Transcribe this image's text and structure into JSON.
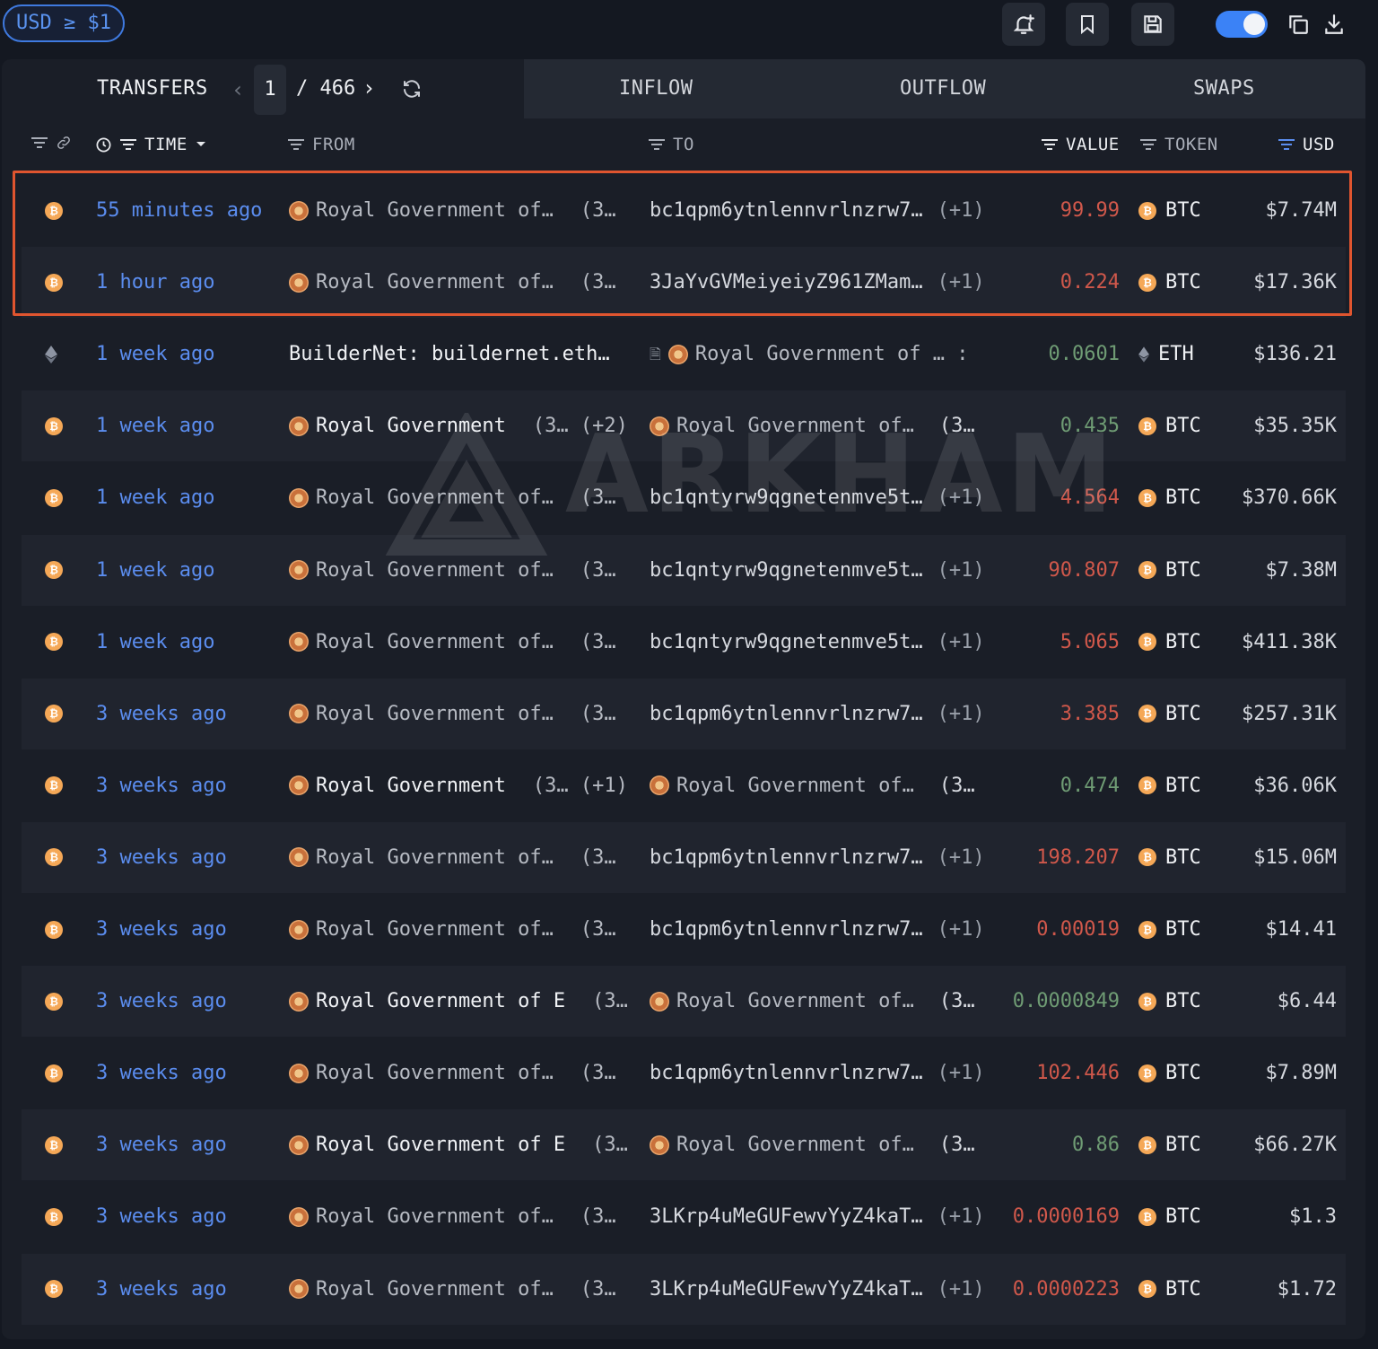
{
  "topbar": {
    "usd_filter": "USD ≥ $1"
  },
  "tabs": {
    "transfers": "TRANSFERS",
    "page_current": "1",
    "page_total": "/ 466",
    "inflow": "INFLOW",
    "outflow": "OUTFLOW",
    "swaps": "SWAPS"
  },
  "headers": {
    "time": "TIME",
    "from": "FROM",
    "to": "TO",
    "value": "VALUE",
    "token": "TOKEN",
    "usd": "USD"
  },
  "watermark": "ARKHAM",
  "rows": [
    {
      "chain": "btc",
      "time": "55 minutes ago",
      "from": "Royal Government of…",
      "from_bold": false,
      "from_extra": "(3…",
      "to": "bc1qpm6ytnlennvrlnzrw7…",
      "to_entity": false,
      "to_plus": "(+1)",
      "value": "99.99",
      "value_color": "red",
      "token": "BTC",
      "usd": "$7.74M"
    },
    {
      "chain": "btc",
      "time": "1 hour ago",
      "from": "Royal Government of…",
      "from_bold": false,
      "from_extra": "(3…",
      "to": "3JaYvGVMeiyeiyZ961ZMam…",
      "to_entity": false,
      "to_plus": "(+1)",
      "value": "0.224",
      "value_color": "red",
      "token": "BTC",
      "usd": "$17.36K"
    },
    {
      "chain": "eth",
      "time": "1 week ago",
      "from": "BuilderNet: buildernet.eth…",
      "from_plain": true,
      "from_bold": true,
      "from_extra": "",
      "to": "Royal Government of … :",
      "to_entity": true,
      "to_doc": true,
      "to_plus": "",
      "value": "0.0601",
      "value_color": "green",
      "token": "ETH",
      "usd": "$136.21"
    },
    {
      "chain": "btc",
      "time": "1 week ago",
      "from": "Royal Government",
      "from_bold": true,
      "from_extra": "(3… (+2)",
      "to": "Royal Government of…",
      "to_entity": true,
      "to_extra": "(3…",
      "to_plus": "",
      "value": "0.435",
      "value_color": "green",
      "token": "BTC",
      "usd": "$35.35K"
    },
    {
      "chain": "btc",
      "time": "1 week ago",
      "from": "Royal Government of…",
      "from_bold": false,
      "from_extra": "(3…",
      "to": "bc1qntyrw9qgnetenmve5t…",
      "to_entity": false,
      "to_plus": "(+1)",
      "value": "4.564",
      "value_color": "red",
      "token": "BTC",
      "usd": "$370.66K"
    },
    {
      "chain": "btc",
      "time": "1 week ago",
      "from": "Royal Government of…",
      "from_bold": false,
      "from_extra": "(3…",
      "to": "bc1qntyrw9qgnetenmve5t…",
      "to_entity": false,
      "to_plus": "(+1)",
      "value": "90.807",
      "value_color": "red",
      "token": "BTC",
      "usd": "$7.38M"
    },
    {
      "chain": "btc",
      "time": "1 week ago",
      "from": "Royal Government of…",
      "from_bold": false,
      "from_extra": "(3…",
      "to": "bc1qntyrw9qgnetenmve5t…",
      "to_entity": false,
      "to_plus": "(+1)",
      "value": "5.065",
      "value_color": "red",
      "token": "BTC",
      "usd": "$411.38K"
    },
    {
      "chain": "btc",
      "time": "3 weeks ago",
      "from": "Royal Government of…",
      "from_bold": false,
      "from_extra": "(3…",
      "to": "bc1qpm6ytnlennvrlnzrw7…",
      "to_entity": false,
      "to_plus": "(+1)",
      "value": "3.385",
      "value_color": "red",
      "token": "BTC",
      "usd": "$257.31K"
    },
    {
      "chain": "btc",
      "time": "3 weeks ago",
      "from": "Royal Government",
      "from_bold": true,
      "from_extra": "(3… (+1)",
      "to": "Royal Government of…",
      "to_entity": true,
      "to_extra": "(3…",
      "to_plus": "",
      "value": "0.474",
      "value_color": "green",
      "token": "BTC",
      "usd": "$36.06K"
    },
    {
      "chain": "btc",
      "time": "3 weeks ago",
      "from": "Royal Government of…",
      "from_bold": false,
      "from_extra": "(3…",
      "to": "bc1qpm6ytnlennvrlnzrw7…",
      "to_entity": false,
      "to_plus": "(+1)",
      "value": "198.207",
      "value_color": "red",
      "token": "BTC",
      "usd": "$15.06M"
    },
    {
      "chain": "btc",
      "time": "3 weeks ago",
      "from": "Royal Government of…",
      "from_bold": false,
      "from_extra": "(3…",
      "to": "bc1qpm6ytnlennvrlnzrw7…",
      "to_entity": false,
      "to_plus": "(+1)",
      "value": "0.00019",
      "value_color": "red",
      "token": "BTC",
      "usd": "$14.41"
    },
    {
      "chain": "btc",
      "time": "3 weeks ago",
      "from": "Royal Government of E",
      "from_bold": true,
      "from_extra": "(3…",
      "to": "Royal Government of…",
      "to_entity": true,
      "to_extra": "(3…",
      "to_plus": "",
      "value": "0.0000849",
      "value_color": "green",
      "token": "BTC",
      "usd": "$6.44"
    },
    {
      "chain": "btc",
      "time": "3 weeks ago",
      "from": "Royal Government of…",
      "from_bold": false,
      "from_extra": "(3…",
      "to": "bc1qpm6ytnlennvrlnzrw7…",
      "to_entity": false,
      "to_plus": "(+1)",
      "value": "102.446",
      "value_color": "red",
      "token": "BTC",
      "usd": "$7.89M"
    },
    {
      "chain": "btc",
      "time": "3 weeks ago",
      "from": "Royal Government of E",
      "from_bold": true,
      "from_extra": "(3…",
      "to": "Royal Government of…",
      "to_entity": true,
      "to_extra": "(3…",
      "to_plus": "",
      "value": "0.86",
      "value_color": "green",
      "token": "BTC",
      "usd": "$66.27K"
    },
    {
      "chain": "btc",
      "time": "3 weeks ago",
      "from": "Royal Government of…",
      "from_bold": false,
      "from_extra": "(3…",
      "to": "3LKrp4uMeGUFewvYyZ4kaT…",
      "to_entity": false,
      "to_plus": "(+1)",
      "value": "0.0000169",
      "value_color": "red",
      "token": "BTC",
      "usd": "$1.3"
    },
    {
      "chain": "btc",
      "time": "3 weeks ago",
      "from": "Royal Government of…",
      "from_bold": false,
      "from_extra": "(3…",
      "to": "3LKrp4uMeGUFewvYyZ4kaT…",
      "to_entity": false,
      "to_plus": "(+1)",
      "value": "0.0000223",
      "value_color": "red",
      "token": "BTC",
      "usd": "$1.72"
    }
  ],
  "colors": {
    "accent": "#3b82f6",
    "time_link": "#5b8def",
    "value_out": "#d0584b",
    "value_in": "#6f9c74",
    "highlight_box": "#e0552f",
    "btc": "#f5a857"
  },
  "icons": [
    "alert-add-icon",
    "bookmark-icon",
    "save-icon",
    "copy-icon",
    "download-icon",
    "refresh-icon",
    "filter-icon",
    "link-icon",
    "clock-icon",
    "btc-icon",
    "eth-icon",
    "entity-icon",
    "document-icon"
  ]
}
